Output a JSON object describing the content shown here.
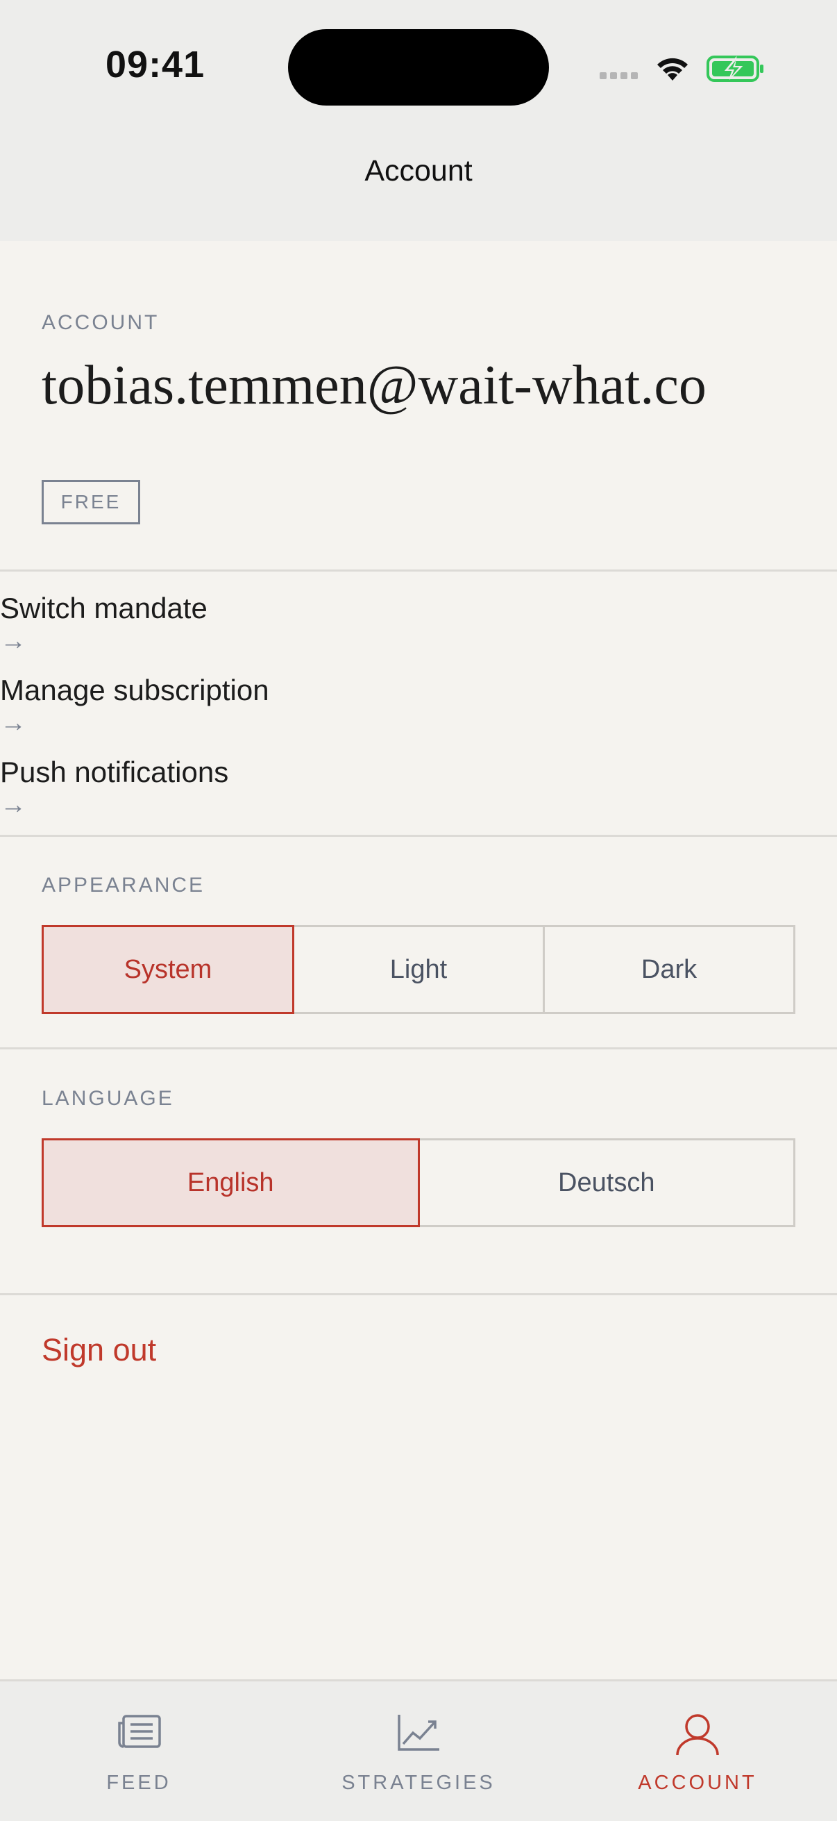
{
  "status_bar": {
    "time": "09:41",
    "signal_icon": "cellular-signal-icon",
    "wifi_icon": "wifi-icon",
    "battery_icon": "battery-charging-icon"
  },
  "header": {
    "title": "Account"
  },
  "account": {
    "section_label": "ACCOUNT",
    "email": "tobias.temmen@wait-what.co",
    "plan": "FREE"
  },
  "menu": {
    "items": [
      {
        "label": "Switch mandate",
        "arrow": "→"
      },
      {
        "label": "Manage subscription",
        "arrow": "→"
      },
      {
        "label": "Push notifications",
        "arrow": "→"
      }
    ]
  },
  "appearance": {
    "section_label": "APPEARANCE",
    "options": [
      "System",
      "Light",
      "Dark"
    ],
    "selected": "System"
  },
  "language": {
    "section_label": "LANGUAGE",
    "options": [
      "English",
      "Deutsch"
    ],
    "selected": "English"
  },
  "sign_out": {
    "label": "Sign out"
  },
  "tabbar": {
    "tabs": [
      {
        "label": "FEED",
        "icon": "newspaper-icon",
        "active": false
      },
      {
        "label": "STRATEGIES",
        "icon": "chart-line-icon",
        "active": false
      },
      {
        "label": "ACCOUNT",
        "icon": "user-icon",
        "active": true
      }
    ]
  },
  "colors": {
    "accent": "#c0392b",
    "accent_bg": "#f0e0dd",
    "muted": "#7a8291",
    "background": "#f5f3ef",
    "bar_background": "#ededeb"
  }
}
